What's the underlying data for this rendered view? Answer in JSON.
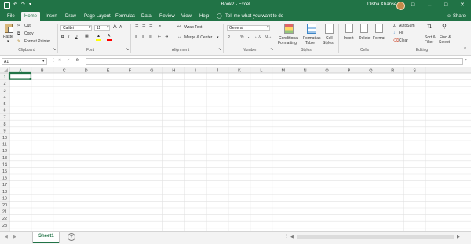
{
  "title": "Book2 - Excel",
  "user": "Disha Khanse",
  "share": "Share",
  "tell_me": "Tell me what you want to do",
  "tabs": [
    "File",
    "Home",
    "Insert",
    "Draw",
    "Page Layout",
    "Formulas",
    "Data",
    "Review",
    "View",
    "Help"
  ],
  "active_tab": "Home",
  "clipboard": {
    "paste": "Paste",
    "cut": "Cut",
    "copy": "Copy",
    "format_painter": "Format Painter",
    "label": "Clipboard"
  },
  "font": {
    "name": "Calibri",
    "size": "11",
    "label": "Font"
  },
  "alignment": {
    "wrap_text": "Wrap Text",
    "merge_center": "Merge & Center",
    "label": "Alignment"
  },
  "number": {
    "format": "General",
    "label": "Number"
  },
  "styles": {
    "conditional": [
      "Conditional",
      "Formatting"
    ],
    "format_table": [
      "Format as",
      "Table"
    ],
    "cell_styles": [
      "Cell",
      "Styles"
    ],
    "label": "Styles"
  },
  "cells": {
    "insert": "Insert",
    "delete": "Delete",
    "format": "Format",
    "label": "Cells"
  },
  "editing": {
    "autosum": "AutoSum",
    "fill": "Fill",
    "clear": "Clear",
    "sort_filter": [
      "Sort &",
      "Filter"
    ],
    "find_select": [
      "Find &",
      "Select"
    ],
    "label": "Editing"
  },
  "name_box": "A1",
  "fx": "fx",
  "columns": [
    "A",
    "B",
    "C",
    "D",
    "E",
    "F",
    "G",
    "H",
    "I",
    "J",
    "K",
    "L",
    "M",
    "N",
    "O",
    "P",
    "Q",
    "R",
    "S"
  ],
  "rows": [
    "1",
    "2",
    "3",
    "4",
    "5",
    "6",
    "7",
    "8",
    "9",
    "10",
    "11",
    "12",
    "13",
    "14",
    "15",
    "16",
    "17",
    "18",
    "19",
    "20",
    "21",
    "22",
    "23"
  ],
  "sheet_tab": "Sheet1",
  "colors": {
    "brand": "#217346",
    "ribbon": "#f3f3f3",
    "grid": "#e1e1e1",
    "selection": "#217346"
  }
}
